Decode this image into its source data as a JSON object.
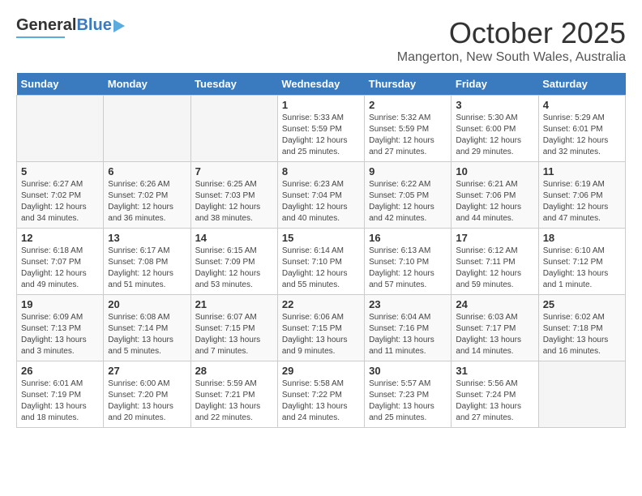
{
  "header": {
    "logo_general": "General",
    "logo_blue": "Blue",
    "title": "October 2025",
    "location": "Mangerton, New South Wales, Australia"
  },
  "days_of_week": [
    "Sunday",
    "Monday",
    "Tuesday",
    "Wednesday",
    "Thursday",
    "Friday",
    "Saturday"
  ],
  "weeks": [
    [
      {
        "day": "",
        "empty": true
      },
      {
        "day": "",
        "empty": true
      },
      {
        "day": "",
        "empty": true
      },
      {
        "day": "1",
        "sunrise": "5:33 AM",
        "sunset": "5:59 PM",
        "daylight": "12 hours and 25 minutes."
      },
      {
        "day": "2",
        "sunrise": "5:32 AM",
        "sunset": "5:59 PM",
        "daylight": "12 hours and 27 minutes."
      },
      {
        "day": "3",
        "sunrise": "5:30 AM",
        "sunset": "6:00 PM",
        "daylight": "12 hours and 29 minutes."
      },
      {
        "day": "4",
        "sunrise": "5:29 AM",
        "sunset": "6:01 PM",
        "daylight": "12 hours and 32 minutes."
      }
    ],
    [
      {
        "day": "5",
        "sunrise": "6:27 AM",
        "sunset": "7:02 PM",
        "daylight": "12 hours and 34 minutes."
      },
      {
        "day": "6",
        "sunrise": "6:26 AM",
        "sunset": "7:02 PM",
        "daylight": "12 hours and 36 minutes."
      },
      {
        "day": "7",
        "sunrise": "6:25 AM",
        "sunset": "7:03 PM",
        "daylight": "12 hours and 38 minutes."
      },
      {
        "day": "8",
        "sunrise": "6:23 AM",
        "sunset": "7:04 PM",
        "daylight": "12 hours and 40 minutes."
      },
      {
        "day": "9",
        "sunrise": "6:22 AM",
        "sunset": "7:05 PM",
        "daylight": "12 hours and 42 minutes."
      },
      {
        "day": "10",
        "sunrise": "6:21 AM",
        "sunset": "7:06 PM",
        "daylight": "12 hours and 44 minutes."
      },
      {
        "day": "11",
        "sunrise": "6:19 AM",
        "sunset": "7:06 PM",
        "daylight": "12 hours and 47 minutes."
      }
    ],
    [
      {
        "day": "12",
        "sunrise": "6:18 AM",
        "sunset": "7:07 PM",
        "daylight": "12 hours and 49 minutes."
      },
      {
        "day": "13",
        "sunrise": "6:17 AM",
        "sunset": "7:08 PM",
        "daylight": "12 hours and 51 minutes."
      },
      {
        "day": "14",
        "sunrise": "6:15 AM",
        "sunset": "7:09 PM",
        "daylight": "12 hours and 53 minutes."
      },
      {
        "day": "15",
        "sunrise": "6:14 AM",
        "sunset": "7:10 PM",
        "daylight": "12 hours and 55 minutes."
      },
      {
        "day": "16",
        "sunrise": "6:13 AM",
        "sunset": "7:10 PM",
        "daylight": "12 hours and 57 minutes."
      },
      {
        "day": "17",
        "sunrise": "6:12 AM",
        "sunset": "7:11 PM",
        "daylight": "12 hours and 59 minutes."
      },
      {
        "day": "18",
        "sunrise": "6:10 AM",
        "sunset": "7:12 PM",
        "daylight": "13 hours and 1 minute."
      }
    ],
    [
      {
        "day": "19",
        "sunrise": "6:09 AM",
        "sunset": "7:13 PM",
        "daylight": "13 hours and 3 minutes."
      },
      {
        "day": "20",
        "sunrise": "6:08 AM",
        "sunset": "7:14 PM",
        "daylight": "13 hours and 5 minutes."
      },
      {
        "day": "21",
        "sunrise": "6:07 AM",
        "sunset": "7:15 PM",
        "daylight": "13 hours and 7 minutes."
      },
      {
        "day": "22",
        "sunrise": "6:06 AM",
        "sunset": "7:15 PM",
        "daylight": "13 hours and 9 minutes."
      },
      {
        "day": "23",
        "sunrise": "6:04 AM",
        "sunset": "7:16 PM",
        "daylight": "13 hours and 11 minutes."
      },
      {
        "day": "24",
        "sunrise": "6:03 AM",
        "sunset": "7:17 PM",
        "daylight": "13 hours and 14 minutes."
      },
      {
        "day": "25",
        "sunrise": "6:02 AM",
        "sunset": "7:18 PM",
        "daylight": "13 hours and 16 minutes."
      }
    ],
    [
      {
        "day": "26",
        "sunrise": "6:01 AM",
        "sunset": "7:19 PM",
        "daylight": "13 hours and 18 minutes."
      },
      {
        "day": "27",
        "sunrise": "6:00 AM",
        "sunset": "7:20 PM",
        "daylight": "13 hours and 20 minutes."
      },
      {
        "day": "28",
        "sunrise": "5:59 AM",
        "sunset": "7:21 PM",
        "daylight": "13 hours and 22 minutes."
      },
      {
        "day": "29",
        "sunrise": "5:58 AM",
        "sunset": "7:22 PM",
        "daylight": "13 hours and 24 minutes."
      },
      {
        "day": "30",
        "sunrise": "5:57 AM",
        "sunset": "7:23 PM",
        "daylight": "13 hours and 25 minutes."
      },
      {
        "day": "31",
        "sunrise": "5:56 AM",
        "sunset": "7:24 PM",
        "daylight": "13 hours and 27 minutes."
      },
      {
        "day": "",
        "empty": true
      }
    ]
  ]
}
